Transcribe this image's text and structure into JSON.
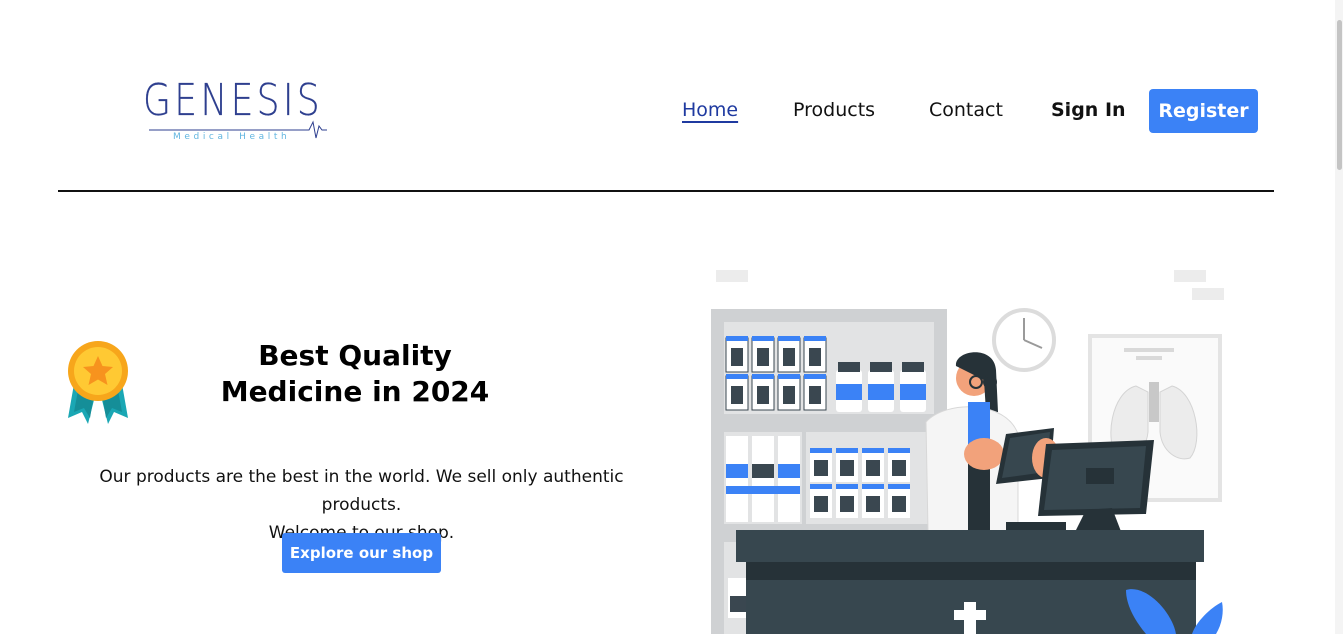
{
  "brand": {
    "name": "GENESIS",
    "tagline": "Medical Health",
    "color": "#2e3f8f",
    "tagline_color": "#62b6e0"
  },
  "nav": {
    "items": [
      {
        "label": "Home",
        "active": true
      },
      {
        "label": "Products",
        "active": false
      },
      {
        "label": "Contact",
        "active": false
      }
    ],
    "signin_label": "Sign In",
    "register_label": "Register",
    "accent": "#3b82f6"
  },
  "hero": {
    "medal_icon": "medal-star-icon",
    "title_line1": "Best Quality",
    "title_line2": "Medicine in 2024",
    "text_line1": "Our products are the best in the world. We sell only authentic products.",
    "text_line2": "Welcome to our shop.",
    "cta_label": "Explore our shop",
    "illustration": "pharmacist-counter-illustration"
  }
}
